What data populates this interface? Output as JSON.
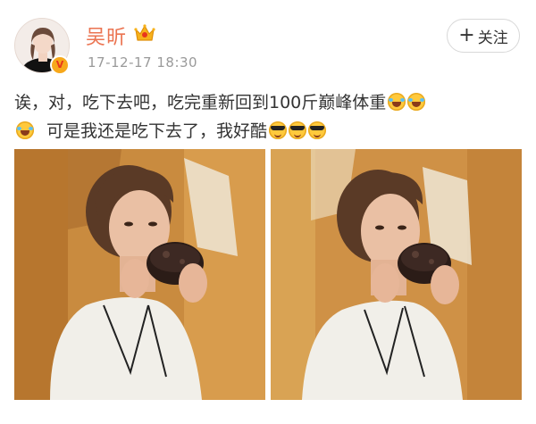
{
  "user": {
    "name": "吴昕",
    "badge_icon": "crown-icon",
    "verified_icon": "verified-v-icon",
    "verified_label": "V"
  },
  "post": {
    "time": "17-12-17 18:30",
    "text_line1": "诶，对，吃下去吧，吃完重新回到100斤巅峰体重",
    "text_line2": "可是我还是吃下去了，我好酷",
    "emojis_line1": [
      "laugh-cry-emoji",
      "laugh-cry-emoji"
    ],
    "emojis_line2_start": [
      "laugh-cry-emoji"
    ],
    "emojis_line2_end": [
      "cool-sunglasses-emoji",
      "cool-sunglasses-emoji",
      "cool-sunglasses-emoji"
    ]
  },
  "follow": {
    "label": "关注",
    "icon": "+"
  },
  "photos": [
    {
      "name": "photo-woman-eating-cake-1"
    },
    {
      "name": "photo-woman-eating-cake-2"
    }
  ],
  "colors": {
    "name": "#eb7350",
    "time": "#9a9a9a",
    "text": "#333333",
    "badge": "#f7a81b"
  }
}
